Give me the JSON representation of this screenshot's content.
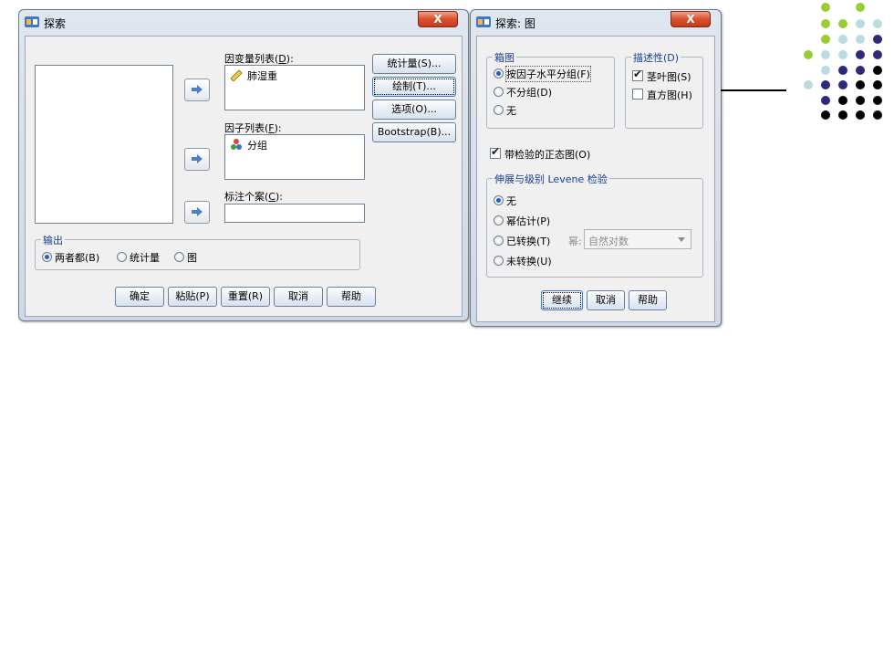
{
  "explore": {
    "title": "探索",
    "close": "X",
    "dependent_label": "因变量列表(",
    "dependent_key": "D",
    "dependent_suffix": "):",
    "dependent_item": "肺湿重",
    "factor_label": "因子列表(",
    "factor_key": "F",
    "factor_suffix": "):",
    "factor_item": "分组",
    "label_cases": "标注个案(",
    "label_cases_key": "C",
    "label_cases_suffix": "):",
    "side_buttons": {
      "statistics": "统计量(S)...",
      "plots": "绘制(T)...",
      "options": "选项(O)...",
      "bootstrap": "Bootstrap(B)..."
    },
    "output_group": "输出",
    "output_both": "两者都(B)",
    "output_stats": "统计量",
    "output_plots": "图",
    "buttons": {
      "ok": "确定",
      "paste": "粘贴(P)",
      "reset": "重置(R)",
      "cancel": "取消",
      "help": "帮助"
    }
  },
  "plots": {
    "title": "探索: 图",
    "close": "X",
    "boxplot_group": "箱图",
    "box_factor": "按因子水平分组(F)",
    "box_together": "不分组(D)",
    "box_none": "无",
    "desc_group": "描述性(D)",
    "stem_leaf": "茎叶图(S)",
    "histogram": "直方图(H)",
    "normality": "带检验的正态图(O)",
    "levene_group": "伸展与级别 Levene 检验",
    "lev_none": "无",
    "lev_power": "幂估计(P)",
    "lev_transformed": "已转换(T)",
    "power_label": "幂:",
    "power_value": "自然对数",
    "lev_untransformed": "未转换(U)",
    "buttons": {
      "continue": "继续",
      "cancel": "取消",
      "help": "帮助"
    }
  },
  "colors": {
    "lime": "#9acd32",
    "light_teal": "#b8dce0",
    "navy": "#2d2a7a",
    "black": "#000000"
  }
}
